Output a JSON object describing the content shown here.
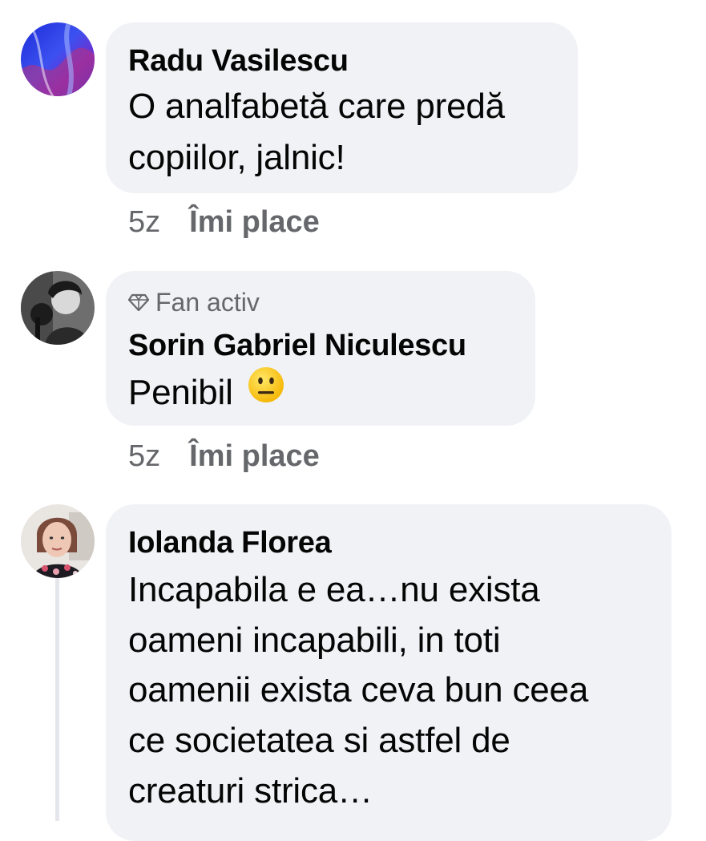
{
  "comments": [
    {
      "author": "Radu Vasilescu",
      "text_lines": [
        "O analfabetă care predă",
        "copiilor, jalnic!"
      ],
      "time": "5z",
      "like_label": "Îmi place"
    },
    {
      "badge": "Fan activ",
      "author": "Sorin Gabriel Niculescu",
      "text": "Penibil",
      "emoji": "neutral-face-emoji",
      "time": "5z",
      "like_label": "Îmi place"
    },
    {
      "author": "Iolanda Florea",
      "text_lines": [
        "Incapabila e ea…nu exista",
        "oameni incapabili, in toti",
        "oamenii exista ceva bun ceea",
        "ce societatea si astfel de",
        "creaturi strica…"
      ]
    }
  ],
  "colors": {
    "bubble": "#f0f2f5",
    "secondary_text": "#65676b",
    "primary_text": "#050505",
    "thread_line": "#e4e6eb"
  }
}
